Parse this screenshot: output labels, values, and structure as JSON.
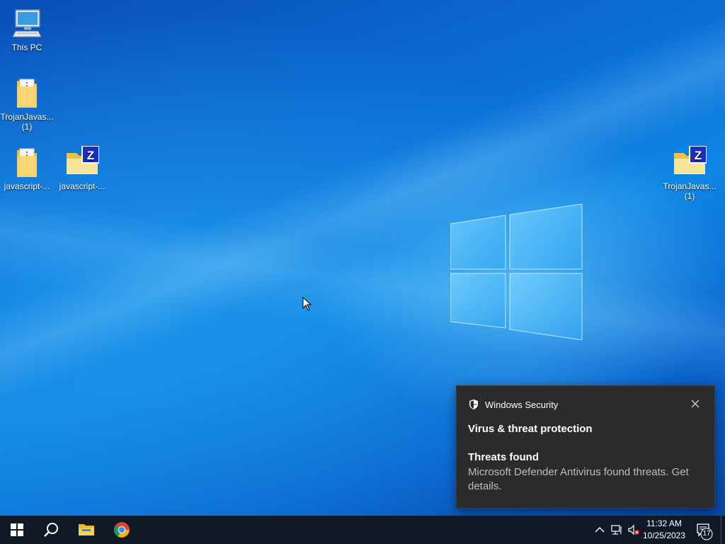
{
  "desktop": {
    "icons": [
      {
        "label": "This PC",
        "icon": "computer-icon"
      },
      {
        "label": "TrojanJavas...",
        "label2": "(1)",
        "icon": "folder-icon"
      },
      {
        "label": "javascript-...",
        "icon": "folder-icon"
      },
      {
        "label": "javascript-...",
        "icon": "zip-folder-icon"
      },
      {
        "label": "TrojanJavas...",
        "label2": "(1)",
        "icon": "zip-folder-icon"
      }
    ]
  },
  "toast": {
    "app_name": "Windows Security",
    "title": "Virus & threat protection",
    "subtitle": "Threats found",
    "body": "Microsoft Defender Antivirus found threats. Get details."
  },
  "taskbar": {
    "clock_time": "11:32 AM",
    "clock_date": "10/25/2023",
    "notification_count": "17",
    "pinned": [
      "start-icon",
      "search-icon",
      "file-explorer-icon",
      "chrome-icon"
    ]
  },
  "colors": {
    "taskbar_bg": "#0f1a26",
    "toast_bg": "#2b2b2b",
    "desktop_blue": "#0b6fd6"
  }
}
